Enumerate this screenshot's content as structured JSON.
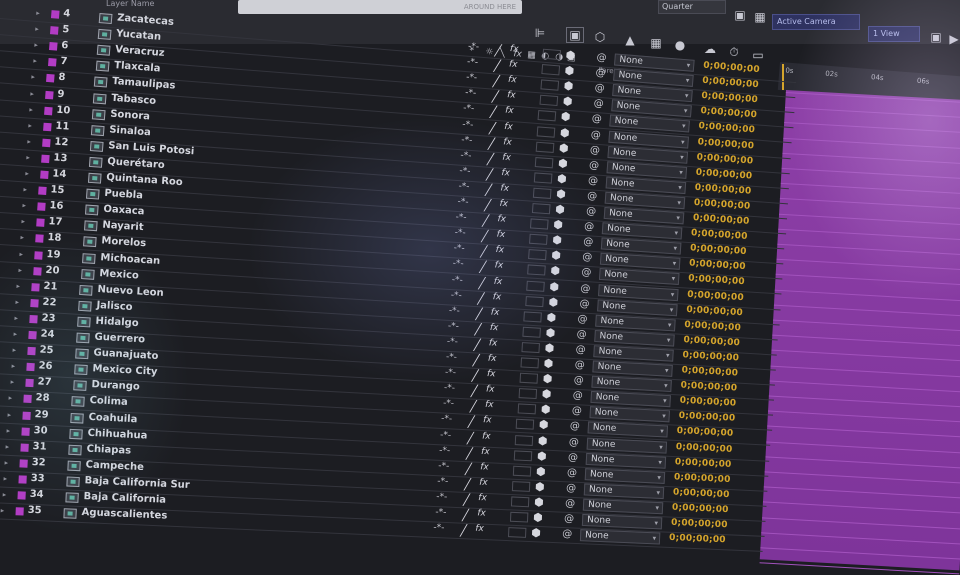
{
  "header": {
    "layer_name_label": "Layer Name",
    "search_hint": "AROUND HERE",
    "quality": "Quarter",
    "camera": "Active Camera",
    "view": "1 View",
    "parent_label": "Parent"
  },
  "ruler": {
    "ticks": [
      "0s",
      "02s",
      "04s",
      "06s"
    ]
  },
  "layers": [
    {
      "num": "4",
      "name": "Zacatecas",
      "parent": "None",
      "timecode": "0;00;00;00"
    },
    {
      "num": "5",
      "name": "Yucatan",
      "parent": "None",
      "timecode": "0;00;00;00"
    },
    {
      "num": "6",
      "name": "Veracruz",
      "parent": "None",
      "timecode": "0;00;00;00"
    },
    {
      "num": "7",
      "name": "Tlaxcala",
      "parent": "None",
      "timecode": "0;00;00;00"
    },
    {
      "num": "8",
      "name": "Tamaulipas",
      "parent": "None",
      "timecode": "0;00;00;00"
    },
    {
      "num": "9",
      "name": "Tabasco",
      "parent": "None",
      "timecode": "0;00;00;00"
    },
    {
      "num": "10",
      "name": "Sonora",
      "parent": "None",
      "timecode": "0;00;00;00"
    },
    {
      "num": "11",
      "name": "Sinaloa",
      "parent": "None",
      "timecode": "0;00;00;00"
    },
    {
      "num": "12",
      "name": "San Luis Potosi",
      "parent": "None",
      "timecode": "0;00;00;00"
    },
    {
      "num": "13",
      "name": "Querétaro",
      "parent": "None",
      "timecode": "0;00;00;00"
    },
    {
      "num": "14",
      "name": "Quintana Roo",
      "parent": "None",
      "timecode": "0;00;00;00"
    },
    {
      "num": "15",
      "name": "Puebla",
      "parent": "None",
      "timecode": "0;00;00;00"
    },
    {
      "num": "16",
      "name": "Oaxaca",
      "parent": "None",
      "timecode": "0;00;00;00"
    },
    {
      "num": "17",
      "name": "Nayarit",
      "parent": "None",
      "timecode": "0;00;00;00"
    },
    {
      "num": "18",
      "name": "Morelos",
      "parent": "None",
      "timecode": "0;00;00;00"
    },
    {
      "num": "19",
      "name": "Michoacan",
      "parent": "None",
      "timecode": "0;00;00;00"
    },
    {
      "num": "20",
      "name": "Mexico",
      "parent": "None",
      "timecode": "0;00;00;00"
    },
    {
      "num": "21",
      "name": "Nuevo Leon",
      "parent": "None",
      "timecode": "0;00;00;00"
    },
    {
      "num": "22",
      "name": "Jalisco",
      "parent": "None",
      "timecode": "0;00;00;00"
    },
    {
      "num": "23",
      "name": "Hidalgo",
      "parent": "None",
      "timecode": "0;00;00;00"
    },
    {
      "num": "24",
      "name": "Guerrero",
      "parent": "None",
      "timecode": "0;00;00;00"
    },
    {
      "num": "25",
      "name": "Guanajuato",
      "parent": "None",
      "timecode": "0;00;00;00"
    },
    {
      "num": "26",
      "name": "Mexico City",
      "parent": "None",
      "timecode": "0;00;00;00"
    },
    {
      "num": "27",
      "name": "Durango",
      "parent": "None",
      "timecode": "0;00;00;00"
    },
    {
      "num": "28",
      "name": "Colima",
      "parent": "None",
      "timecode": "0;00;00;00"
    },
    {
      "num": "29",
      "name": "Coahuila",
      "parent": "None",
      "timecode": "0;00;00;00"
    },
    {
      "num": "30",
      "name": "Chihuahua",
      "parent": "None",
      "timecode": "0;00;00;00"
    },
    {
      "num": "31",
      "name": "Chiapas",
      "parent": "None",
      "timecode": "0;00;00;00"
    },
    {
      "num": "32",
      "name": "Campeche",
      "parent": "None",
      "timecode": "0;00;00;00"
    },
    {
      "num": "33",
      "name": "Baja California Sur",
      "parent": "None",
      "timecode": "0;00;00;00"
    },
    {
      "num": "34",
      "name": "Baja California",
      "parent": "None",
      "timecode": "0;00;00;00"
    },
    {
      "num": "35",
      "name": "Aguascalientes",
      "parent": "None",
      "timecode": "0;00;00;00"
    }
  ],
  "colors": {
    "label_chip": "#b23cc4",
    "timecode": "#d5a52c",
    "timeline_bar": "#8d3fa7"
  },
  "icons": {
    "twirl": "▸",
    "comp": "comp-icon",
    "shy": "shy-switch-icon",
    "pen": "quality-pen-icon",
    "fx": "fx",
    "cube": "3d-layer-icon",
    "pickwhip": "pickwhip-icon",
    "caret": "▾"
  }
}
